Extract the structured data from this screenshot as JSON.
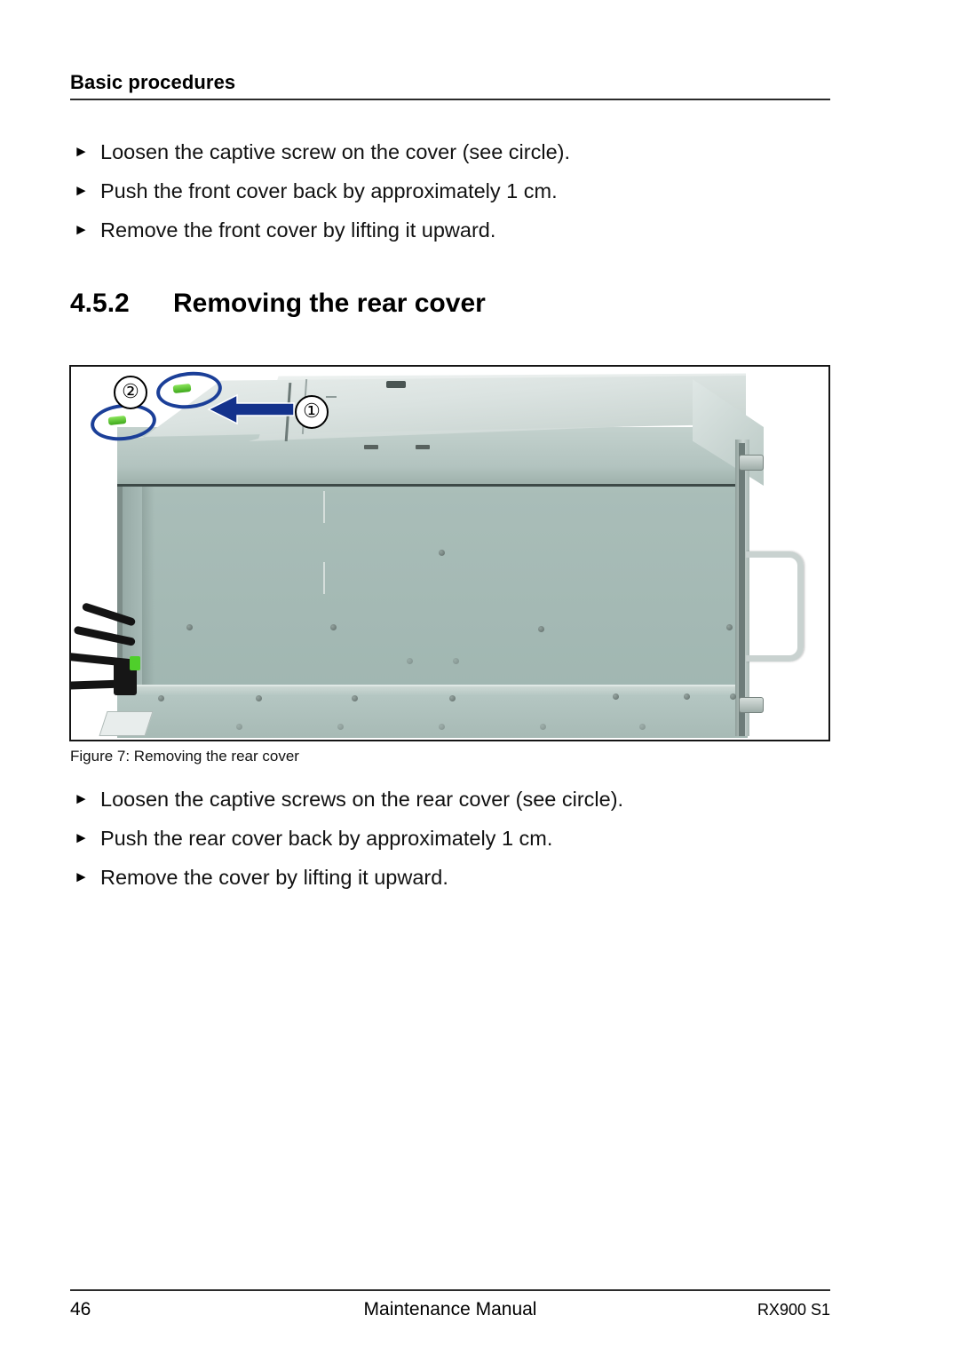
{
  "header": {
    "title": "Basic procedures"
  },
  "steps_front_cover": [
    {
      "marker": "►",
      "text": "Loosen the captive screw on the cover (see circle)."
    },
    {
      "marker": "►",
      "text": "Push the front cover back by approximately 1 cm."
    },
    {
      "marker": "►",
      "text": "Remove the front cover by lifting it upward."
    }
  ],
  "section": {
    "number": "4.5.2",
    "title": "Removing the rear cover"
  },
  "figure": {
    "caption": "Figure 7: Removing the rear cover",
    "callouts": [
      {
        "label": "②",
        "meaning": "captive-screws-circled"
      },
      {
        "label": "①",
        "meaning": "push-direction-arrow"
      }
    ],
    "annotation_color": "#1b3f98",
    "chassis_color": "#a4b9b4",
    "captive_screw_color": "#4fcf2b"
  },
  "steps_rear_cover": [
    {
      "marker": "►",
      "text": "Loosen the captive screws on the rear cover (see circle)."
    },
    {
      "marker": "►",
      "text": "Push the rear cover back by approximately 1 cm."
    },
    {
      "marker": "►",
      "text": "Remove the cover by lifting it upward."
    }
  ],
  "footer": {
    "page_number": "46",
    "center_text": "Maintenance Manual",
    "right_text": "RX900 S1"
  }
}
